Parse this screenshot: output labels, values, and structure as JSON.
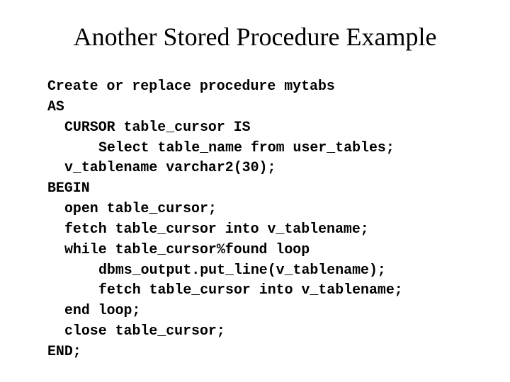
{
  "slide": {
    "title": "Another Stored Procedure Example",
    "code_lines": [
      {
        "indent": 0,
        "text": "Create or replace procedure mytabs"
      },
      {
        "indent": 0,
        "text": "AS"
      },
      {
        "indent": 1,
        "text": "CURSOR table_cursor IS"
      },
      {
        "indent": 2,
        "text": "Select table_name from user_tables;"
      },
      {
        "indent": 1,
        "text": "v_tablename varchar2(30);"
      },
      {
        "indent": 0,
        "text": "BEGIN"
      },
      {
        "indent": 1,
        "text": "open table_cursor;"
      },
      {
        "indent": 1,
        "text": "fetch table_cursor into v_tablename;"
      },
      {
        "indent": 1,
        "text": "while table_cursor%found loop"
      },
      {
        "indent": 2,
        "text": "dbms_output.put_line(v_tablename);"
      },
      {
        "indent": 2,
        "text": "fetch table_cursor into v_tablename;"
      },
      {
        "indent": 1,
        "text": "end loop;"
      },
      {
        "indent": 1,
        "text": "close table_cursor;"
      },
      {
        "indent": 0,
        "text": "END;"
      }
    ]
  }
}
